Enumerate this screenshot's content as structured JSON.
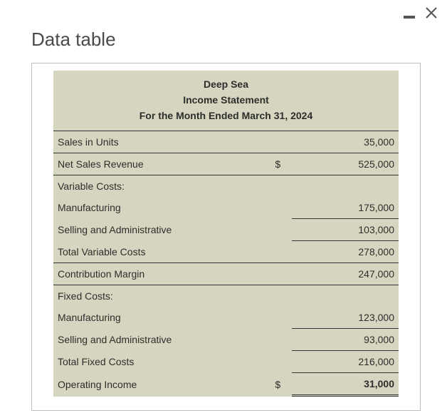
{
  "window": {
    "title": "Data table"
  },
  "statement": {
    "header": {
      "company": "Deep Sea",
      "title": "Income Statement",
      "period": "For the Month Ended March 31, 2024"
    },
    "currency_symbol": "$",
    "rows": {
      "sales_units": {
        "label": "Sales in Units",
        "value": "35,000"
      },
      "net_sales_revenue": {
        "label": "Net Sales Revenue",
        "value": "525,000"
      },
      "variable_costs_heading": {
        "label": "Variable Costs:"
      },
      "vc_manufacturing": {
        "label": "Manufacturing",
        "value": "175,000"
      },
      "vc_selling_admin": {
        "label": "Selling and Administrative",
        "value": "103,000"
      },
      "total_variable_costs": {
        "label": "Total Variable Costs",
        "value": "278,000"
      },
      "contribution_margin": {
        "label": "Contribution Margin",
        "value": "247,000"
      },
      "fixed_costs_heading": {
        "label": "Fixed Costs:"
      },
      "fc_manufacturing": {
        "label": "Manufacturing",
        "value": "123,000"
      },
      "fc_selling_admin": {
        "label": "Selling and Administrative",
        "value": "93,000"
      },
      "total_fixed_costs": {
        "label": "Total Fixed Costs",
        "value": "216,000"
      },
      "operating_income": {
        "label": "Operating Income",
        "value": "31,000"
      }
    }
  }
}
